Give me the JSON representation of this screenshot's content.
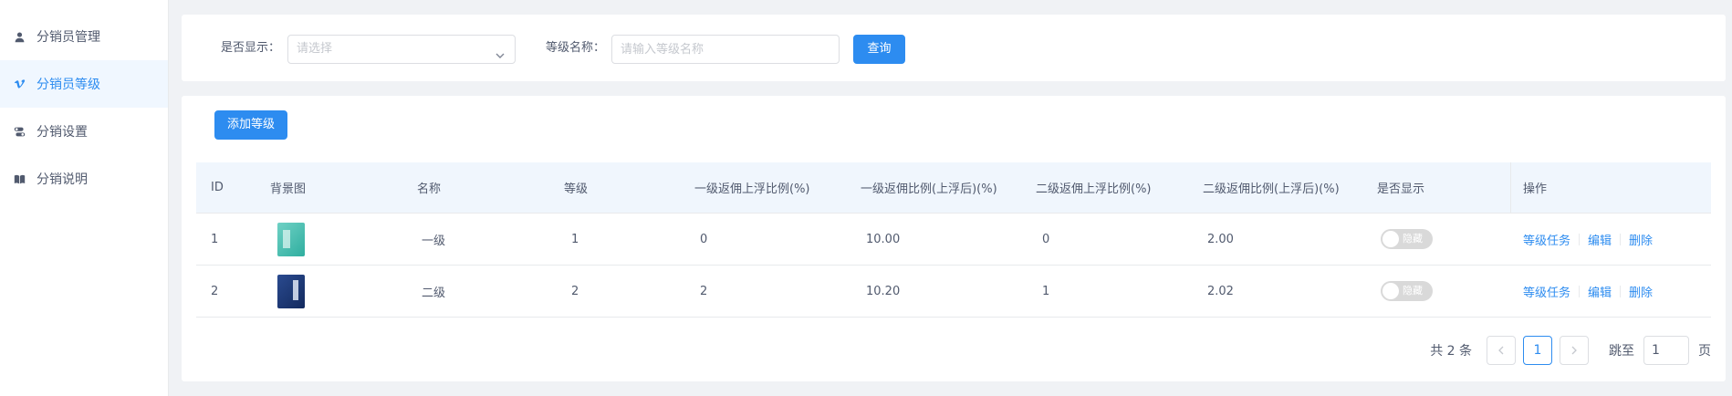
{
  "sidebar": {
    "items": [
      {
        "label": "分销员管理",
        "icon": "user-icon"
      },
      {
        "label": "分销员等级",
        "icon": "vimeo-icon",
        "active": true
      },
      {
        "label": "分销设置",
        "icon": "toggles-icon"
      },
      {
        "label": "分销说明",
        "icon": "book-icon"
      }
    ]
  },
  "filter": {
    "show_label": "是否显示：",
    "show_placeholder": "请选择",
    "name_label": "等级名称：",
    "name_placeholder": "请输入等级名称",
    "query_label": "查询"
  },
  "toolbar": {
    "add_label": "添加等级"
  },
  "table": {
    "headers": [
      "ID",
      "背景图",
      "名称",
      "等级",
      "一级返佣上浮比例(%)",
      "一级返佣比例(上浮后)(%)",
      "二级返佣上浮比例(%)",
      "二级返佣比例(上浮后)(%)",
      "是否显示",
      "操作"
    ],
    "rows": [
      {
        "id": "1",
        "name": "一级",
        "grade": "1",
        "l1_float": "0",
        "l1_rate": "10.00",
        "l2_float": "0",
        "l2_rate": "2.00",
        "visible_label": "隐藏",
        "visible": false
      },
      {
        "id": "2",
        "name": "二级",
        "grade": "2",
        "l1_float": "2",
        "l1_rate": "10.20",
        "l2_float": "1",
        "l2_rate": "2.02",
        "visible_label": "隐藏",
        "visible": false
      }
    ],
    "actions": {
      "task": "等级任务",
      "edit": "编辑",
      "delete": "删除"
    }
  },
  "pagination": {
    "total_text": "共 2 条",
    "current_page": "1",
    "jump_label": "跳至",
    "jump_value": "1",
    "page_suffix": "页"
  },
  "colors": {
    "accent": "#2d8cf0",
    "header_bg": "#f0f6fd"
  }
}
